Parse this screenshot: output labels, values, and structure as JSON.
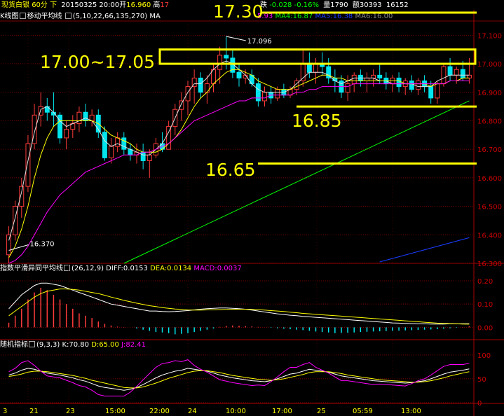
{
  "header": {
    "instrument": "现货白银",
    "period": "60分",
    "nav": "下",
    "date_time": "20150325 20:00",
    "open_label": "开",
    "open_value": "16.960",
    "high_label": "高",
    "high_value": "17",
    "change_label": "跌",
    "change_value": "-0.028",
    "change_pct": "-0.16%",
    "volume_label": "量",
    "volume_value": "1790",
    "amount_label": "额",
    "amount_value": "30393",
    "extra_value": "16152"
  },
  "ma_bar": {
    "kline_label": "K线图",
    "ma_label": "移动平均线",
    "ma_params": "(5,10,22,66,135,270)",
    "ma_prefix": "MA",
    "ma3_value": "5.93",
    "ma4_label": "MA4:16.87",
    "ma5_label": "MA5:16.38",
    "ma6_label": "MA6:16.00"
  },
  "macd_bar": {
    "name": "指数平滑异同平均线",
    "params": "(26,12,9)",
    "diff": "DIFF:0.0153",
    "dea": "DEA:0.0134",
    "macd": "MACD:0.0037"
  },
  "kdj_bar": {
    "name": "随机指标",
    "params": "(9,3,3)",
    "k": "K:70.80",
    "d": "D:65.00",
    "j": "J:82.41"
  },
  "annotations": {
    "level_1730": "17.30",
    "level_1700": "17.00~17.05",
    "level_1685": "16.85",
    "level_1665": "16.65",
    "max_price": "17.096",
    "min_price": "16.370"
  },
  "x_labels": [
    "3",
    "21",
    "23",
    "15:00",
    "22:00",
    "24",
    "10:00",
    "17:00",
    "25",
    "05:59",
    "13:00"
  ],
  "colors": {
    "bg": "#000000",
    "grid": "#7a0000",
    "axis_text": "#cc0000",
    "up": "#ff3b3b",
    "down": "#00e5ee",
    "ma1": "#e0e0e0",
    "ma2": "#ffff00",
    "ma3": "#ff00ff",
    "ma4": "#00ff00",
    "ma5": "#1a3cff",
    "ma6": "#888888",
    "annotation": "#ffff00"
  },
  "chart_data": [
    {
      "type": "candlestick",
      "name": "现货白银 60分",
      "ylim": [
        16.3,
        17.15
      ],
      "y_ticks": [
        "17.100",
        "17.000",
        "16.900",
        "16.800",
        "16.700",
        "16.600",
        "16.500",
        "16.400",
        "16.300"
      ],
      "candles": [
        [
          16.33,
          16.43,
          16.3,
          16.4
        ],
        [
          16.4,
          16.52,
          16.38,
          16.5
        ],
        [
          16.5,
          16.6,
          16.46,
          16.57
        ],
        [
          16.57,
          16.75,
          16.55,
          16.72
        ],
        [
          16.72,
          16.86,
          16.7,
          16.82
        ],
        [
          16.82,
          16.9,
          16.78,
          16.85
        ],
        [
          16.85,
          16.88,
          16.8,
          16.83
        ],
        [
          16.83,
          16.9,
          16.78,
          16.82
        ],
        [
          16.82,
          16.83,
          16.72,
          16.74
        ],
        [
          16.74,
          16.8,
          16.7,
          16.77
        ],
        [
          16.77,
          16.82,
          16.74,
          16.79
        ],
        [
          16.79,
          16.85,
          16.76,
          16.83
        ],
        [
          16.83,
          16.86,
          16.78,
          16.8
        ],
        [
          16.8,
          16.84,
          16.78,
          16.82
        ],
        [
          16.82,
          16.84,
          16.74,
          16.76
        ],
        [
          16.76,
          16.78,
          16.66,
          16.67
        ],
        [
          16.67,
          16.74,
          16.65,
          16.71
        ],
        [
          16.71,
          16.76,
          16.69,
          16.74
        ],
        [
          16.74,
          16.76,
          16.68,
          16.7
        ],
        [
          16.7,
          16.72,
          16.66,
          16.68
        ],
        [
          16.68,
          16.72,
          16.65,
          16.69
        ],
        [
          16.69,
          16.72,
          16.63,
          16.66
        ],
        [
          16.66,
          16.7,
          16.6,
          16.68
        ],
        [
          16.68,
          16.74,
          16.67,
          16.72
        ],
        [
          16.72,
          16.76,
          16.69,
          16.7
        ],
        [
          16.7,
          16.8,
          16.7,
          16.78
        ],
        [
          16.78,
          16.86,
          16.75,
          16.84
        ],
        [
          16.84,
          16.9,
          16.8,
          16.87
        ],
        [
          16.87,
          16.94,
          16.82,
          16.92
        ],
        [
          16.92,
          16.98,
          16.86,
          16.95
        ],
        [
          16.95,
          16.97,
          16.88,
          16.9
        ],
        [
          16.9,
          16.96,
          16.86,
          16.93
        ],
        [
          16.93,
          17.0,
          16.9,
          16.98
        ],
        [
          16.98,
          17.06,
          16.93,
          17.03
        ],
        [
          17.03,
          17.096,
          16.98,
          17.02
        ],
        [
          17.02,
          17.05,
          16.95,
          16.97
        ],
        [
          16.97,
          17.0,
          16.92,
          16.95
        ],
        [
          16.95,
          16.98,
          16.93,
          16.96
        ],
        [
          16.96,
          16.98,
          16.92,
          16.93
        ],
        [
          16.93,
          16.95,
          16.85,
          16.87
        ],
        [
          16.87,
          16.92,
          16.85,
          16.9
        ],
        [
          16.9,
          16.92,
          16.86,
          16.88
        ],
        [
          16.88,
          16.92,
          16.87,
          16.91
        ],
        [
          16.91,
          16.93,
          16.88,
          16.89
        ],
        [
          16.89,
          16.92,
          16.88,
          16.91
        ],
        [
          16.91,
          16.95,
          16.89,
          16.94
        ],
        [
          16.94,
          17.05,
          16.92,
          17.0
        ],
        [
          17.0,
          17.04,
          16.95,
          16.97
        ],
        [
          16.97,
          17.02,
          16.93,
          17.0
        ],
        [
          17.0,
          17.04,
          16.96,
          16.99
        ],
        [
          16.99,
          17.02,
          16.93,
          16.95
        ],
        [
          16.95,
          16.98,
          16.9,
          16.94
        ],
        [
          16.94,
          16.96,
          16.88,
          16.9
        ],
        [
          16.9,
          16.96,
          16.87,
          16.93
        ],
        [
          16.93,
          16.97,
          16.9,
          16.96
        ],
        [
          16.96,
          16.98,
          16.92,
          16.94
        ],
        [
          16.94,
          16.97,
          16.9,
          16.95
        ],
        [
          16.95,
          16.98,
          16.92,
          16.96
        ],
        [
          16.96,
          17.0,
          16.93,
          16.95
        ],
        [
          16.95,
          16.97,
          16.91,
          16.93
        ],
        [
          16.93,
          16.96,
          16.9,
          16.95
        ],
        [
          16.95,
          16.97,
          16.9,
          16.92
        ],
        [
          16.92,
          16.95,
          16.89,
          16.94
        ],
        [
          16.94,
          16.96,
          16.9,
          16.91
        ],
        [
          16.91,
          16.95,
          16.89,
          16.94
        ],
        [
          16.94,
          16.96,
          16.9,
          16.92
        ],
        [
          16.92,
          16.94,
          16.86,
          16.88
        ],
        [
          16.88,
          16.94,
          16.86,
          16.93
        ],
        [
          16.93,
          17.0,
          16.92,
          16.99
        ],
        [
          16.99,
          17.02,
          16.94,
          16.96
        ],
        [
          16.96,
          16.99,
          16.93,
          16.98
        ],
        [
          16.98,
          17.01,
          16.94,
          16.95
        ],
        [
          16.95,
          17.02,
          16.93,
          16.96
        ]
      ],
      "ma_lines": [
        {
          "name": "MA1",
          "points": [
            16.38,
            16.46,
            16.55,
            16.66,
            16.76,
            16.84,
            16.85,
            16.83,
            16.8,
            16.78,
            16.79,
            16.8,
            16.81,
            16.8,
            16.77,
            16.73,
            16.71,
            16.72,
            16.71,
            16.7,
            16.69,
            16.68,
            16.68,
            16.7,
            16.72,
            16.76,
            16.81,
            16.86,
            16.9,
            16.93,
            16.93,
            16.95,
            16.98,
            17.0,
            17.01,
            17.0,
            16.98,
            16.96,
            16.93,
            16.91,
            16.9,
            16.9,
            16.9,
            16.9,
            16.91,
            16.93,
            16.95,
            16.97,
            16.97,
            16.97,
            16.96,
            16.94,
            16.93,
            16.94,
            16.95,
            16.95,
            16.95,
            16.95,
            16.94,
            16.94,
            16.93,
            16.93,
            16.93,
            16.93,
            16.92,
            16.92,
            16.92,
            16.94,
            16.95,
            16.96,
            16.96,
            16.96,
            16.96
          ]
        },
        {
          "name": "MA2",
          "points": [
            16.32,
            16.36,
            16.42,
            16.5,
            16.6,
            16.68,
            16.74,
            16.78,
            16.8,
            16.8,
            16.8,
            16.8,
            16.8,
            16.8,
            16.79,
            16.77,
            16.75,
            16.74,
            16.73,
            16.72,
            16.7,
            16.69,
            16.69,
            16.69,
            16.7,
            16.72,
            16.74,
            16.77,
            16.81,
            16.85,
            16.88,
            16.9,
            16.93,
            16.95,
            16.97,
            16.98,
            16.98,
            16.97,
            16.96,
            16.94,
            16.93,
            16.92,
            16.91,
            16.91,
            16.91,
            16.92,
            16.93,
            16.94,
            16.95,
            16.96,
            16.96,
            16.95,
            16.95,
            16.94,
            16.94,
            16.94,
            16.94,
            16.94,
            16.94,
            16.94,
            16.94,
            16.94,
            16.93,
            16.93,
            16.93,
            16.93,
            16.92,
            16.93,
            16.93,
            16.94,
            16.94,
            16.95,
            16.95
          ]
        },
        {
          "name": "MA3",
          "points": [
            16.3,
            16.31,
            16.33,
            16.36,
            16.4,
            16.44,
            16.48,
            16.51,
            16.54,
            16.56,
            16.58,
            16.6,
            16.62,
            16.63,
            16.64,
            16.65,
            16.66,
            16.67,
            16.68,
            16.68,
            16.68,
            16.69,
            16.69,
            16.7,
            16.71,
            16.72,
            16.74,
            16.76,
            16.78,
            16.8,
            16.81,
            16.82,
            16.83,
            16.84,
            16.85,
            16.86,
            16.87,
            16.87,
            16.88,
            16.88,
            16.88,
            16.89,
            16.89,
            16.89,
            16.89,
            16.9,
            16.9,
            16.91,
            16.91,
            16.92,
            16.92,
            16.92,
            16.92,
            16.92,
            16.93,
            16.93,
            16.93,
            16.93,
            16.93,
            16.93,
            16.93,
            16.93,
            16.93,
            16.93,
            16.93,
            16.93,
            16.93,
            16.93,
            16.93,
            16.94,
            16.94,
            16.94,
            16.94
          ]
        }
      ],
      "ma4_segment": {
        "from": [
          18,
          16.3
        ],
        "to": [
          72,
          16.87
        ]
      },
      "ma5_segment": {
        "from": [
          58,
          16.305
        ],
        "to": [
          72,
          16.39
        ]
      }
    },
    {
      "type": "bar",
      "name": "MACD",
      "ylim": [
        -0.05,
        0.23
      ],
      "y_ticks": [
        "0.20",
        "0.10",
        "0.00"
      ],
      "hist": [
        0.02,
        0.05,
        0.08,
        0.12,
        0.15,
        0.17,
        0.16,
        0.14,
        0.12,
        0.1,
        0.08,
        0.06,
        0.05,
        0.04,
        0.025,
        0.015,
        0.008,
        0.003,
        0.001,
        0.0,
        -0.005,
        -0.01,
        -0.015,
        -0.02,
        -0.022,
        -0.025,
        -0.03,
        -0.028,
        -0.025,
        -0.02,
        -0.015,
        -0.01,
        -0.005,
        0.002,
        0.006,
        0.008,
        0.007,
        0.005,
        0.004,
        0.002,
        0.0,
        -0.002,
        -0.004,
        -0.006,
        -0.008,
        -0.01,
        -0.012,
        -0.015,
        -0.018,
        -0.02,
        -0.022,
        -0.025,
        -0.024,
        -0.023,
        -0.022,
        -0.02,
        -0.019,
        -0.018,
        -0.017,
        -0.016,
        -0.015,
        -0.014,
        -0.013,
        -0.012,
        -0.011,
        -0.01,
        -0.009,
        -0.008,
        -0.006,
        -0.004,
        -0.002,
        0.001,
        0.004
      ],
      "diff": [
        0.08,
        0.11,
        0.14,
        0.16,
        0.18,
        0.19,
        0.19,
        0.185,
        0.18,
        0.17,
        0.16,
        0.15,
        0.14,
        0.13,
        0.12,
        0.11,
        0.1,
        0.095,
        0.09,
        0.085,
        0.08,
        0.075,
        0.07,
        0.07,
        0.068,
        0.067,
        0.068,
        0.07,
        0.072,
        0.075,
        0.078,
        0.08,
        0.082,
        0.083,
        0.083,
        0.082,
        0.08,
        0.078,
        0.074,
        0.07,
        0.066,
        0.062,
        0.058,
        0.055,
        0.052,
        0.05,
        0.047,
        0.045,
        0.043,
        0.041,
        0.039,
        0.037,
        0.035,
        0.033,
        0.031,
        0.029,
        0.027,
        0.025,
        0.023,
        0.021,
        0.019,
        0.018,
        0.017,
        0.016,
        0.015,
        0.015,
        0.014,
        0.014,
        0.014,
        0.015,
        0.015,
        0.0153,
        0.0153
      ],
      "dea": [
        0.05,
        0.07,
        0.09,
        0.11,
        0.13,
        0.145,
        0.155,
        0.16,
        0.165,
        0.165,
        0.163,
        0.16,
        0.155,
        0.15,
        0.145,
        0.138,
        0.13,
        0.123,
        0.116,
        0.11,
        0.104,
        0.098,
        0.093,
        0.089,
        0.085,
        0.082,
        0.079,
        0.077,
        0.075,
        0.074,
        0.074,
        0.075,
        0.075,
        0.076,
        0.077,
        0.078,
        0.078,
        0.078,
        0.077,
        0.076,
        0.074,
        0.072,
        0.07,
        0.068,
        0.065,
        0.063,
        0.06,
        0.058,
        0.056,
        0.054,
        0.052,
        0.05,
        0.048,
        0.046,
        0.044,
        0.042,
        0.04,
        0.038,
        0.036,
        0.034,
        0.032,
        0.03,
        0.028,
        0.026,
        0.024,
        0.022,
        0.02,
        0.018,
        0.017,
        0.016,
        0.015,
        0.014,
        0.0134
      ]
    },
    {
      "type": "line",
      "name": "KDJ",
      "ylim": [
        0,
        110
      ],
      "y_ticks": [
        "100",
        "50",
        "0"
      ],
      "k": [
        58,
        62,
        68,
        72,
        70,
        66,
        62,
        60,
        58,
        55,
        52,
        48,
        45,
        40,
        35,
        32,
        30,
        28,
        26,
        28,
        32,
        38,
        45,
        52,
        58,
        62,
        66,
        68,
        72,
        70,
        68,
        66,
        62,
        58,
        55,
        52,
        50,
        48,
        46,
        45,
        44,
        46,
        50,
        55,
        60,
        62,
        66,
        70,
        68,
        66,
        64,
        60,
        56,
        54,
        52,
        50,
        48,
        46,
        45,
        44,
        43,
        42,
        41,
        42,
        44,
        46,
        50,
        55,
        60,
        64,
        66,
        68,
        70.8
      ],
      "d": [
        55,
        57,
        60,
        64,
        66,
        66,
        65,
        63,
        61,
        59,
        57,
        54,
        51,
        47,
        44,
        41,
        38,
        35,
        32,
        31,
        31,
        33,
        37,
        41,
        46,
        51,
        55,
        59,
        63,
        66,
        67,
        67,
        65,
        63,
        60,
        57,
        55,
        53,
        51,
        49,
        48,
        47,
        48,
        50,
        53,
        56,
        59,
        63,
        65,
        65,
        65,
        63,
        61,
        58,
        56,
        54,
        52,
        50,
        48,
        47,
        46,
        45,
        44,
        43,
        43,
        44,
        46,
        49,
        52,
        56,
        59,
        62,
        65
      ],
      "j": [
        65,
        72,
        84,
        88,
        78,
        66,
        56,
        54,
        52,
        47,
        42,
        36,
        33,
        26,
        17,
        14,
        14,
        14,
        14,
        22,
        34,
        48,
        61,
        74,
        82,
        84,
        88,
        86,
        90,
        78,
        70,
        64,
        56,
        48,
        45,
        42,
        40,
        38,
        36,
        37,
        36,
        44,
        54,
        65,
        74,
        74,
        80,
        84,
        74,
        68,
        62,
        54,
        46,
        46,
        44,
        42,
        40,
        38,
        39,
        38,
        37,
        36,
        35,
        40,
        46,
        50,
        58,
        67,
        76,
        80,
        80,
        80,
        82.41
      ]
    }
  ]
}
